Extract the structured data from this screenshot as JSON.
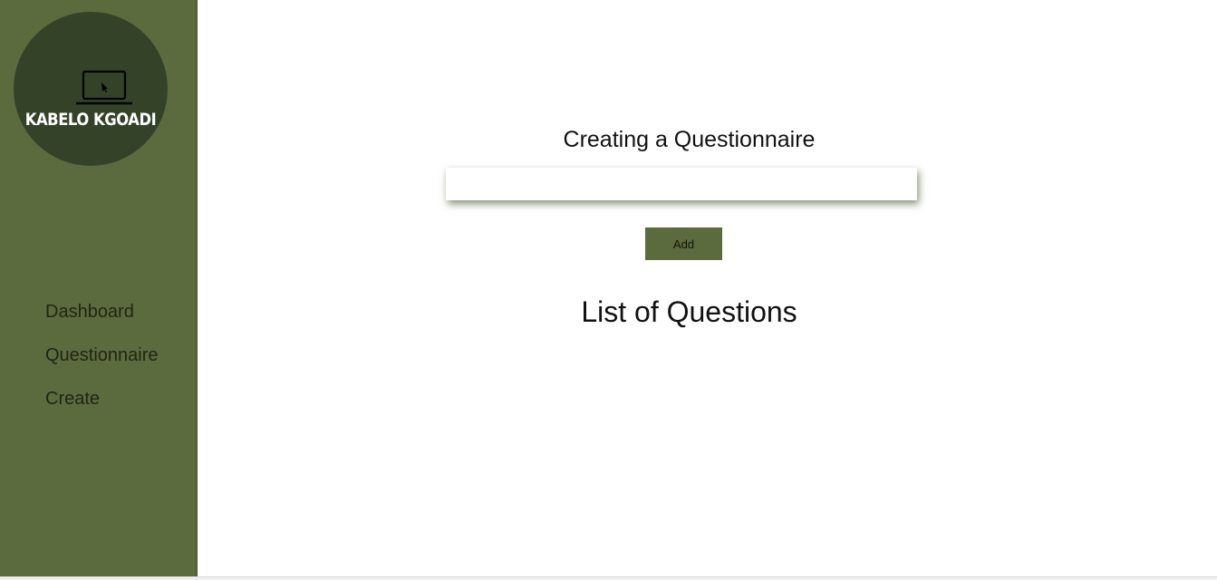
{
  "brand": {
    "name": "KABELO KGOADI",
    "icon": "laptop-cursor-icon"
  },
  "sidebar": {
    "items": [
      {
        "label": "Dashboard"
      },
      {
        "label": "Questionnaire"
      },
      {
        "label": "Create"
      }
    ]
  },
  "main": {
    "title": "Creating a Questionnaire",
    "input": {
      "value": "",
      "placeholder": ""
    },
    "add_label": "Add",
    "list_title": "List of Questions"
  },
  "colors": {
    "sidebar": "#5c6b3d",
    "logo_circle": "#344228",
    "button": "#5c6b3d"
  }
}
